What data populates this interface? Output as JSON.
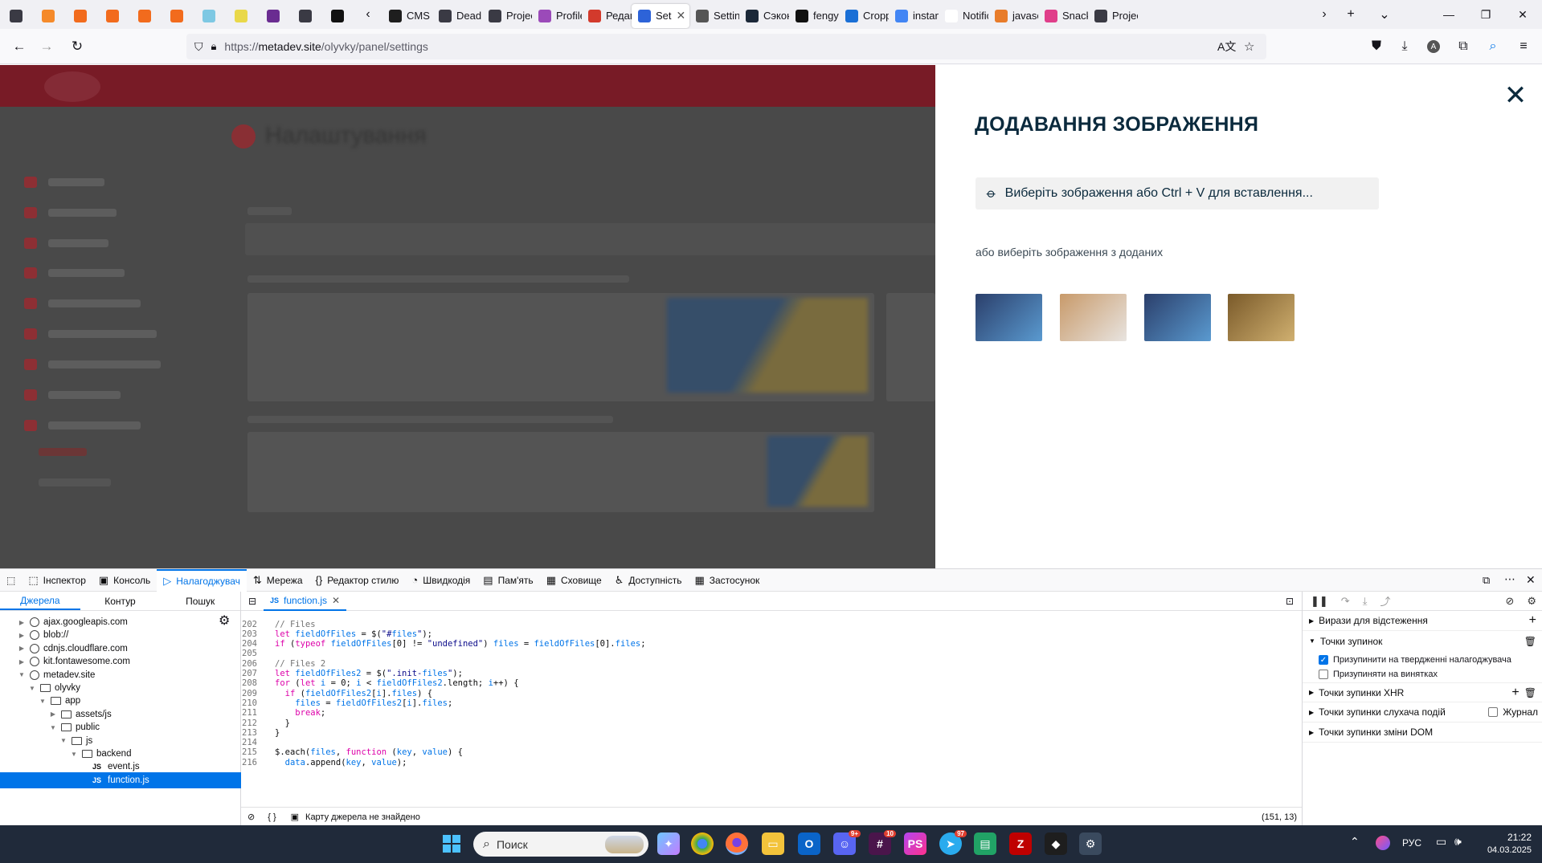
{
  "browser": {
    "tabs": [
      {
        "label": "",
        "fav_color": "#3a3a44",
        "icon": "tab-list-icon",
        "type": "pinned"
      },
      {
        "label": "",
        "fav_color": "#f58a2a",
        "icon": "w-logo-icon",
        "type": "pinned"
      },
      {
        "label": "",
        "fav_color": "#f26b1d",
        "icon": "cpanel-icon",
        "type": "pinned"
      },
      {
        "label": "",
        "fav_color": "#f26b1d",
        "icon": "cpanel-icon",
        "type": "pinned"
      },
      {
        "label": "",
        "fav_color": "#f26b1d",
        "icon": "cpanel-icon",
        "type": "pinned"
      },
      {
        "label": "",
        "fav_color": "#f26b1d",
        "icon": "cpanel-icon",
        "type": "pinned"
      },
      {
        "label": "",
        "fav_color": "#7ec8e3",
        "icon": "tools-icon",
        "type": "pinned"
      },
      {
        "label": "",
        "fav_color": "#e9d84a",
        "icon": "circle-icon",
        "type": "pinned"
      },
      {
        "label": "",
        "fav_color": "#6a2c91",
        "icon": "notes-icon",
        "type": "pinned"
      },
      {
        "label": "",
        "fav_color": "#3a3a44",
        "icon": "openai-icon",
        "type": "pinned"
      },
      {
        "label": "",
        "fav_color": "#111111",
        "icon": "target-icon",
        "type": "pinned"
      },
      {
        "label": "CMS -",
        "fav_color": "#1e1e1e",
        "icon": "figma-icon",
        "type": "normal"
      },
      {
        "label": "Deadl",
        "fav_color": "#3a3a44",
        "icon": "openai-icon",
        "type": "normal"
      },
      {
        "label": "Projec",
        "fav_color": "#3a3a44",
        "icon": "openai-icon",
        "type": "normal"
      },
      {
        "label": "Profile",
        "fav_color": "#9b4ab9",
        "icon": "profile-icon",
        "type": "normal"
      },
      {
        "label": "Редаг",
        "fav_color": "#d33a2c",
        "icon": "play-icon",
        "type": "normal"
      },
      {
        "label": "Set",
        "fav_color": "#2d63d8",
        "icon": "metadev-icon",
        "type": "active"
      },
      {
        "label": "Settin",
        "fav_color": "#555555",
        "icon": "settings-icon",
        "type": "normal"
      },
      {
        "label": "Сэкон",
        "fav_color": "#1b2838",
        "icon": "steam-icon",
        "type": "normal"
      },
      {
        "label": "fengy",
        "fav_color": "#111111",
        "icon": "github-icon",
        "type": "normal"
      },
      {
        "label": "Cropp",
        "fav_color": "#1a6fd6",
        "icon": "facebook-icon",
        "type": "normal"
      },
      {
        "label": "instan",
        "fav_color": "#4285f4",
        "icon": "google-icon",
        "type": "normal"
      },
      {
        "label": "Notificatic",
        "fav_color": "#ffffff",
        "icon": "blank-icon",
        "type": "normal"
      },
      {
        "label": "javasc",
        "fav_color": "#e87c2a",
        "icon": "js-icon",
        "type": "normal"
      },
      {
        "label": "Snack",
        "fav_color": "#e03e8a",
        "icon": "snack-icon",
        "type": "normal"
      },
      {
        "label": "Projec",
        "fav_color": "#3a3a44",
        "icon": "openai-icon",
        "type": "normal"
      }
    ],
    "url_prefix": "https://",
    "url_host": "metadev.site",
    "url_path": "/olyvky/panel/settings"
  },
  "page": {
    "background_title": "Налаштування"
  },
  "modal": {
    "title": "ДОДАВАННЯ ЗОБРАЖЕННЯ",
    "upload_label": "Виберіть зображення або Ctrl + V для вставлення...",
    "or_text": "або виберіть зображення з доданих",
    "thumbnails": [
      {
        "alt": "surgeons-operating",
        "color_a": "#2b3f6b",
        "color_b": "#5a9ad0"
      },
      {
        "alt": "doctors-talking",
        "color_a": "#c89a6a",
        "color_b": "#e8e4e0"
      },
      {
        "alt": "surgeons-operating-2",
        "color_a": "#2b3f6b",
        "color_b": "#5a9ad0"
      },
      {
        "alt": "medicine-bottles",
        "color_a": "#7a5a2a",
        "color_b": "#d0b070"
      }
    ]
  },
  "devtools": {
    "tabs": [
      {
        "label": "Інспектор",
        "icon": "inspector-icon"
      },
      {
        "label": "Консоль",
        "icon": "console-icon"
      },
      {
        "label": "Налагоджувач",
        "icon": "debugger-icon"
      },
      {
        "label": "Мережа",
        "icon": "network-icon"
      },
      {
        "label": "Редактор стилю",
        "icon": "style-editor-icon"
      },
      {
        "label": "Швидкодія",
        "icon": "performance-icon"
      },
      {
        "label": "Пам'ять",
        "icon": "memory-icon"
      },
      {
        "label": "Сховище",
        "icon": "storage-icon"
      },
      {
        "label": "Доступність",
        "icon": "accessibility-icon"
      },
      {
        "label": "Застосунок",
        "icon": "application-icon"
      }
    ],
    "source_tabs": [
      "Джерела",
      "Контур",
      "Пошук"
    ],
    "tree": [
      {
        "label": "ajax.googleapis.com",
        "type": "domain",
        "indent": 0,
        "open": false
      },
      {
        "label": "blob://",
        "type": "domain",
        "indent": 0,
        "open": false
      },
      {
        "label": "cdnjs.cloudflare.com",
        "type": "domain",
        "indent": 0,
        "open": false
      },
      {
        "label": "kit.fontawesome.com",
        "type": "domain",
        "indent": 0,
        "open": false
      },
      {
        "label": "metadev.site",
        "type": "domain",
        "indent": 0,
        "open": true
      },
      {
        "label": "olyvky",
        "type": "folder",
        "indent": 1,
        "open": true
      },
      {
        "label": "app",
        "type": "folder",
        "indent": 2,
        "open": true
      },
      {
        "label": "assets/js",
        "type": "folder",
        "indent": 3,
        "open": false
      },
      {
        "label": "public",
        "type": "folder",
        "indent": 3,
        "open": true
      },
      {
        "label": "js",
        "type": "folder",
        "indent": 4,
        "open": true
      },
      {
        "label": "backend",
        "type": "folder",
        "indent": 5,
        "open": true
      },
      {
        "label": "event.js",
        "type": "file",
        "indent": 6,
        "open": false
      },
      {
        "label": "function.js",
        "type": "file",
        "indent": 6,
        "open": false,
        "selected": true
      }
    ],
    "editor_tab": "function.js",
    "code_lines": [
      {
        "n": "202",
        "text": "// Files"
      },
      {
        "n": "203",
        "text": "let fieldOfFiles = $(\"#files\");"
      },
      {
        "n": "204",
        "text": "if (typeof fieldOfFiles[0] != \"undefined\") files = fieldOfFiles[0].files;"
      },
      {
        "n": "205",
        "text": ""
      },
      {
        "n": "206",
        "text": "// Files 2"
      },
      {
        "n": "207",
        "text": "let fieldOfFiles2 = $(\".init-files\");"
      },
      {
        "n": "208",
        "text": "for (let i = 0; i < fieldOfFiles2.length; i++) {"
      },
      {
        "n": "209",
        "text": "  if (fieldOfFiles2[i].files) {"
      },
      {
        "n": "210",
        "text": "    files = fieldOfFiles2[i].files;"
      },
      {
        "n": "211",
        "text": "    break;"
      },
      {
        "n": "212",
        "text": "  }"
      },
      {
        "n": "213",
        "text": "}"
      },
      {
        "n": "214",
        "text": ""
      },
      {
        "n": "215",
        "text": "$.each(files, function (key, value) {"
      },
      {
        "n": "216",
        "text": "  data.append(key, value);"
      }
    ],
    "status_text": "Карту джерела не знайдено",
    "cursor_pos": "(151, 13)",
    "right_panel": {
      "watch": "Вирази для відстеження",
      "breakpoints": "Точки зупинок",
      "pause_debugger": "Призупинити на твердженні налагоджувача",
      "pause_exceptions": "Призупиняти на винятках",
      "xhr": "Точки зупинки XHR",
      "events": "Точки зупинки слухача подій",
      "log": "Журнал",
      "dom": "Точки зупинки зміни DOM"
    }
  },
  "taskbar": {
    "search_label": "Поиск",
    "lang": "РУС",
    "time": "21:22",
    "date": "04.03.2025",
    "badges": {
      "discord": "9+",
      "slack": "10",
      "telegram": "97"
    }
  }
}
